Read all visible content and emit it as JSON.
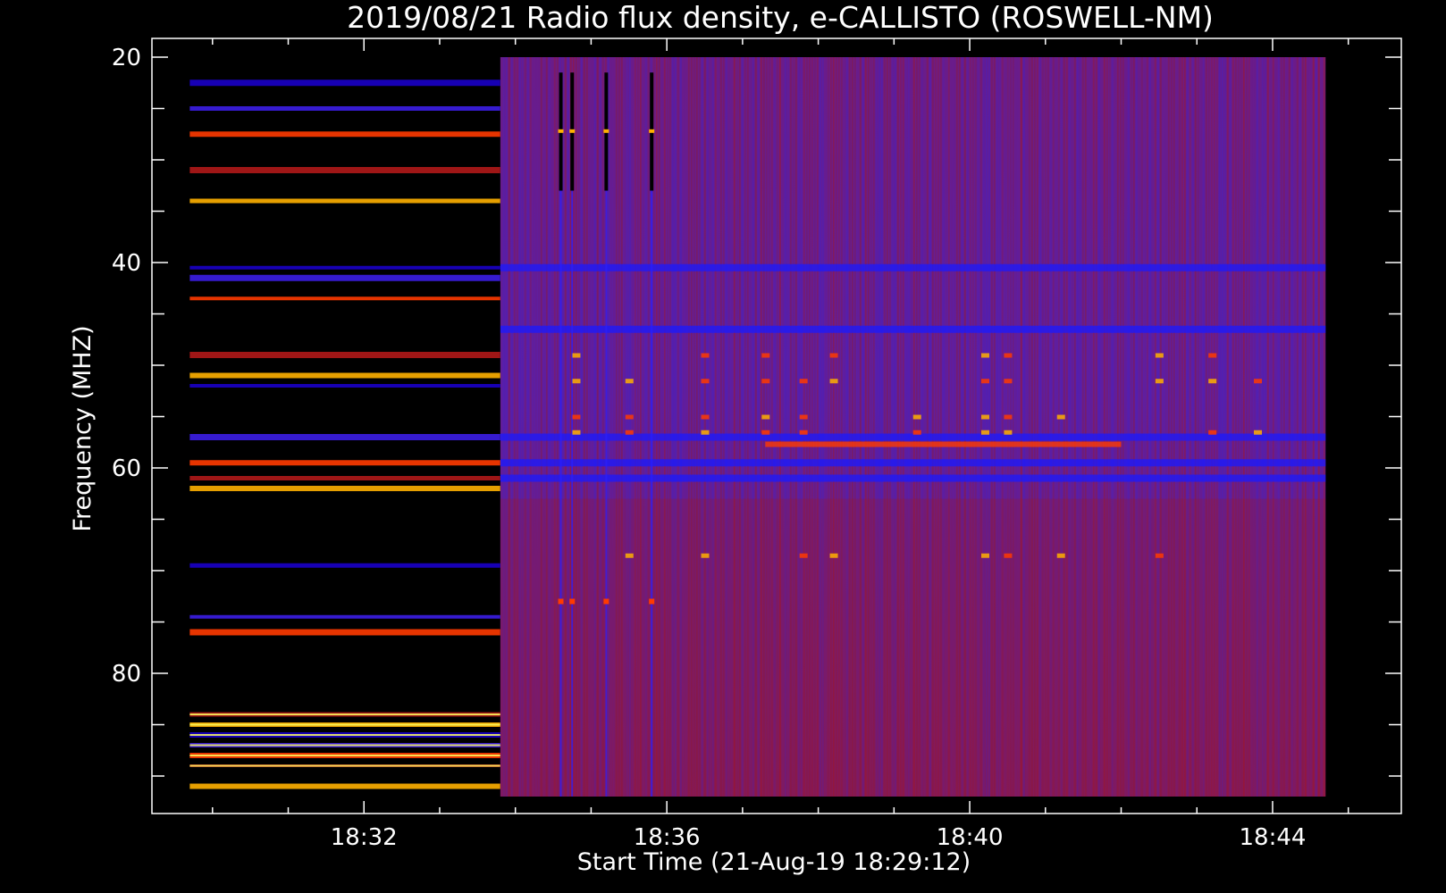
{
  "chart_data": {
    "type": "heatmap",
    "title": "2019/08/21  Radio flux density, e-CALLISTO (ROSWELL-NM)",
    "xlabel": "Start Time (21-Aug-19 18:29:12)",
    "ylabel": "Frequency (MHZ)",
    "x_ticks": [
      "18:32",
      "18:36",
      "18:40",
      "18:44"
    ],
    "x_tick_minutes": [
      32,
      36,
      40,
      44
    ],
    "y_ticks": [
      "20",
      "40",
      "60",
      "80"
    ],
    "y_tick_values": [
      20,
      40,
      60,
      80
    ],
    "xlim_minutes": [
      29.2,
      45.7
    ],
    "ylim_mhz": [
      20,
      92
    ],
    "y_inverted": true,
    "data_start_minute": 29.7,
    "data_gap_end_minute": 33.8,
    "data_end_minute": 44.7,
    "colormap": [
      "#000000",
      "#1a00c8",
      "#3c1ee6",
      "#7a1a8c",
      "#b01818",
      "#ff3a00",
      "#ffb000",
      "#ffff60"
    ],
    "background_level": "purple-red",
    "bright_bands_mhz": [
      22.5,
      25,
      27.5,
      31,
      34,
      40.5,
      41.5,
      43.5,
      49,
      51,
      52,
      57,
      59.5,
      61,
      62,
      69.5,
      74.5,
      76,
      84,
      85,
      86,
      87,
      88,
      89,
      91
    ],
    "blue_bands_mhz": [
      40.5,
      46.5,
      57,
      59.5,
      61
    ],
    "burst_times_minutes": [
      34.6,
      34.75,
      35.2,
      35.8
    ],
    "interference_times_minutes": [
      34.8,
      35.5,
      36.5,
      37.3,
      37.8,
      38.2,
      39.3,
      40.2,
      40.5,
      41.2,
      42.5,
      43.2,
      43.8
    ]
  }
}
